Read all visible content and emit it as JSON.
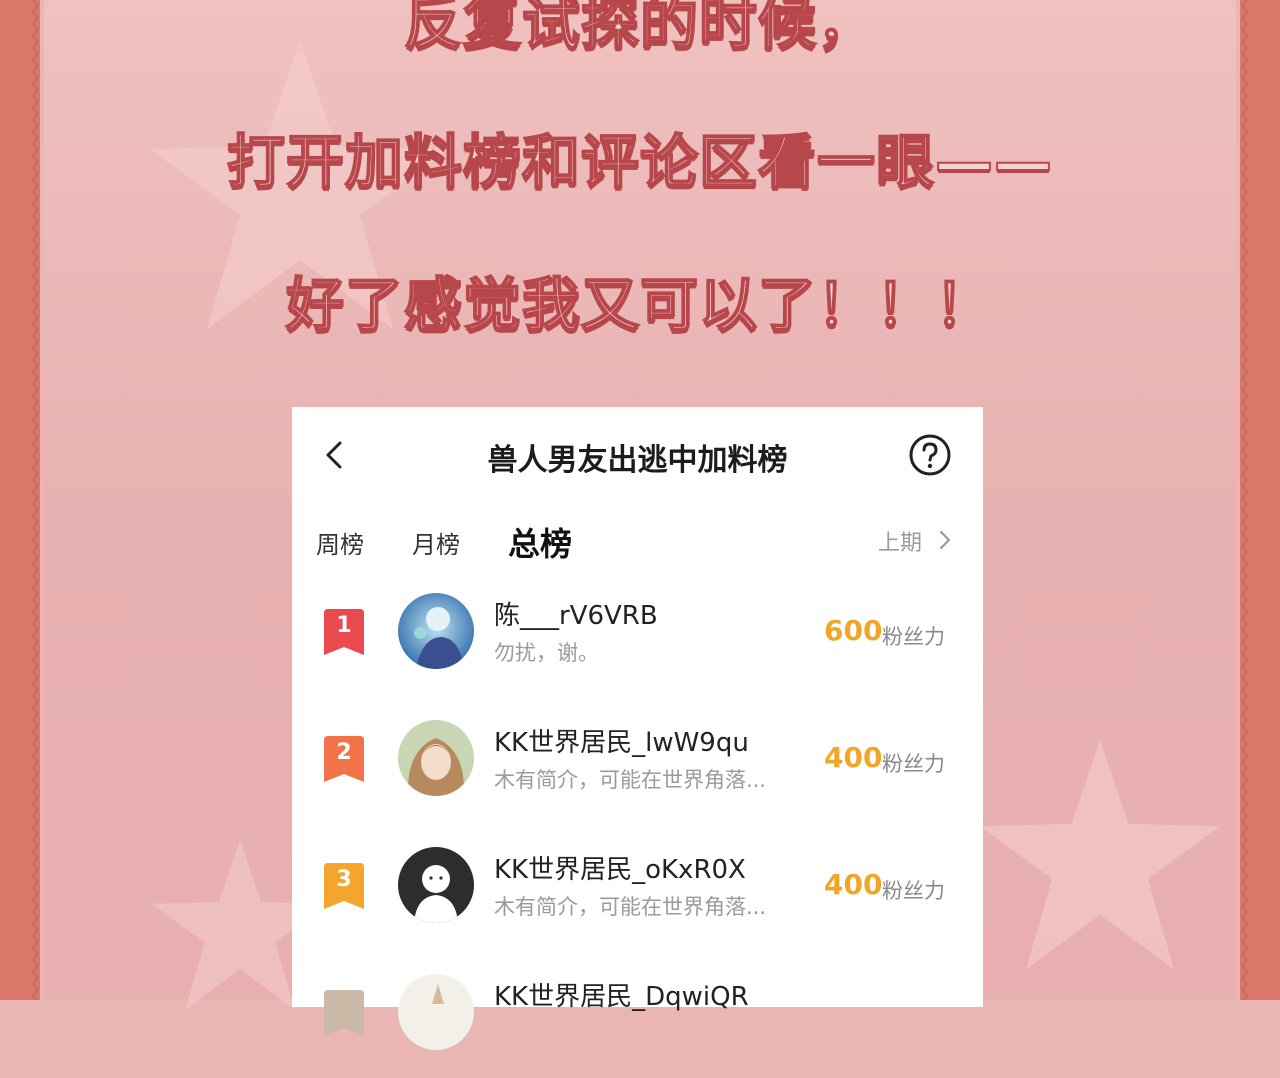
{
  "headline": {
    "line0": "反复试探的时候，",
    "line1": "打开加料榜和评论区看一眼——",
    "line2": "好了感觉我又可以了！！！"
  },
  "card": {
    "title": "兽人男友出逃中加料榜",
    "back_icon": "chevron-left-icon",
    "help_icon": "question-circle-icon",
    "tabs": [
      {
        "label": "周榜",
        "active": false
      },
      {
        "label": "月榜",
        "active": false
      },
      {
        "label": "总榜",
        "active": true
      }
    ],
    "prev_period_label": "上期",
    "rows": [
      {
        "rank": "1",
        "badge_color": "#e84a4e",
        "name": "陈___rV6VRB",
        "bio": "勿扰，谢。",
        "score": "600",
        "unit": "粉丝力"
      },
      {
        "rank": "2",
        "badge_color": "#f2734a",
        "name": "KK世界居民_lwW9qu",
        "bio": "木有简介，可能在世界角落...",
        "score": "400",
        "unit": "粉丝力"
      },
      {
        "rank": "3",
        "badge_color": "#f4a52c",
        "name": "KK世界居民_oKxR0X",
        "bio": "木有简介，可能在世界角落...",
        "score": "400",
        "unit": "粉丝力"
      },
      {
        "rank": "",
        "badge_color": "#c9b9a6",
        "name": "KK世界居民_DqwiQR",
        "bio": "",
        "score": "",
        "unit": ""
      }
    ]
  },
  "colors": {
    "side_band": "#d8776a",
    "background": "#e9b6b4",
    "headline_fill": "#f7d3cf",
    "headline_stroke": "#b7474b",
    "score": "#f0a728"
  }
}
